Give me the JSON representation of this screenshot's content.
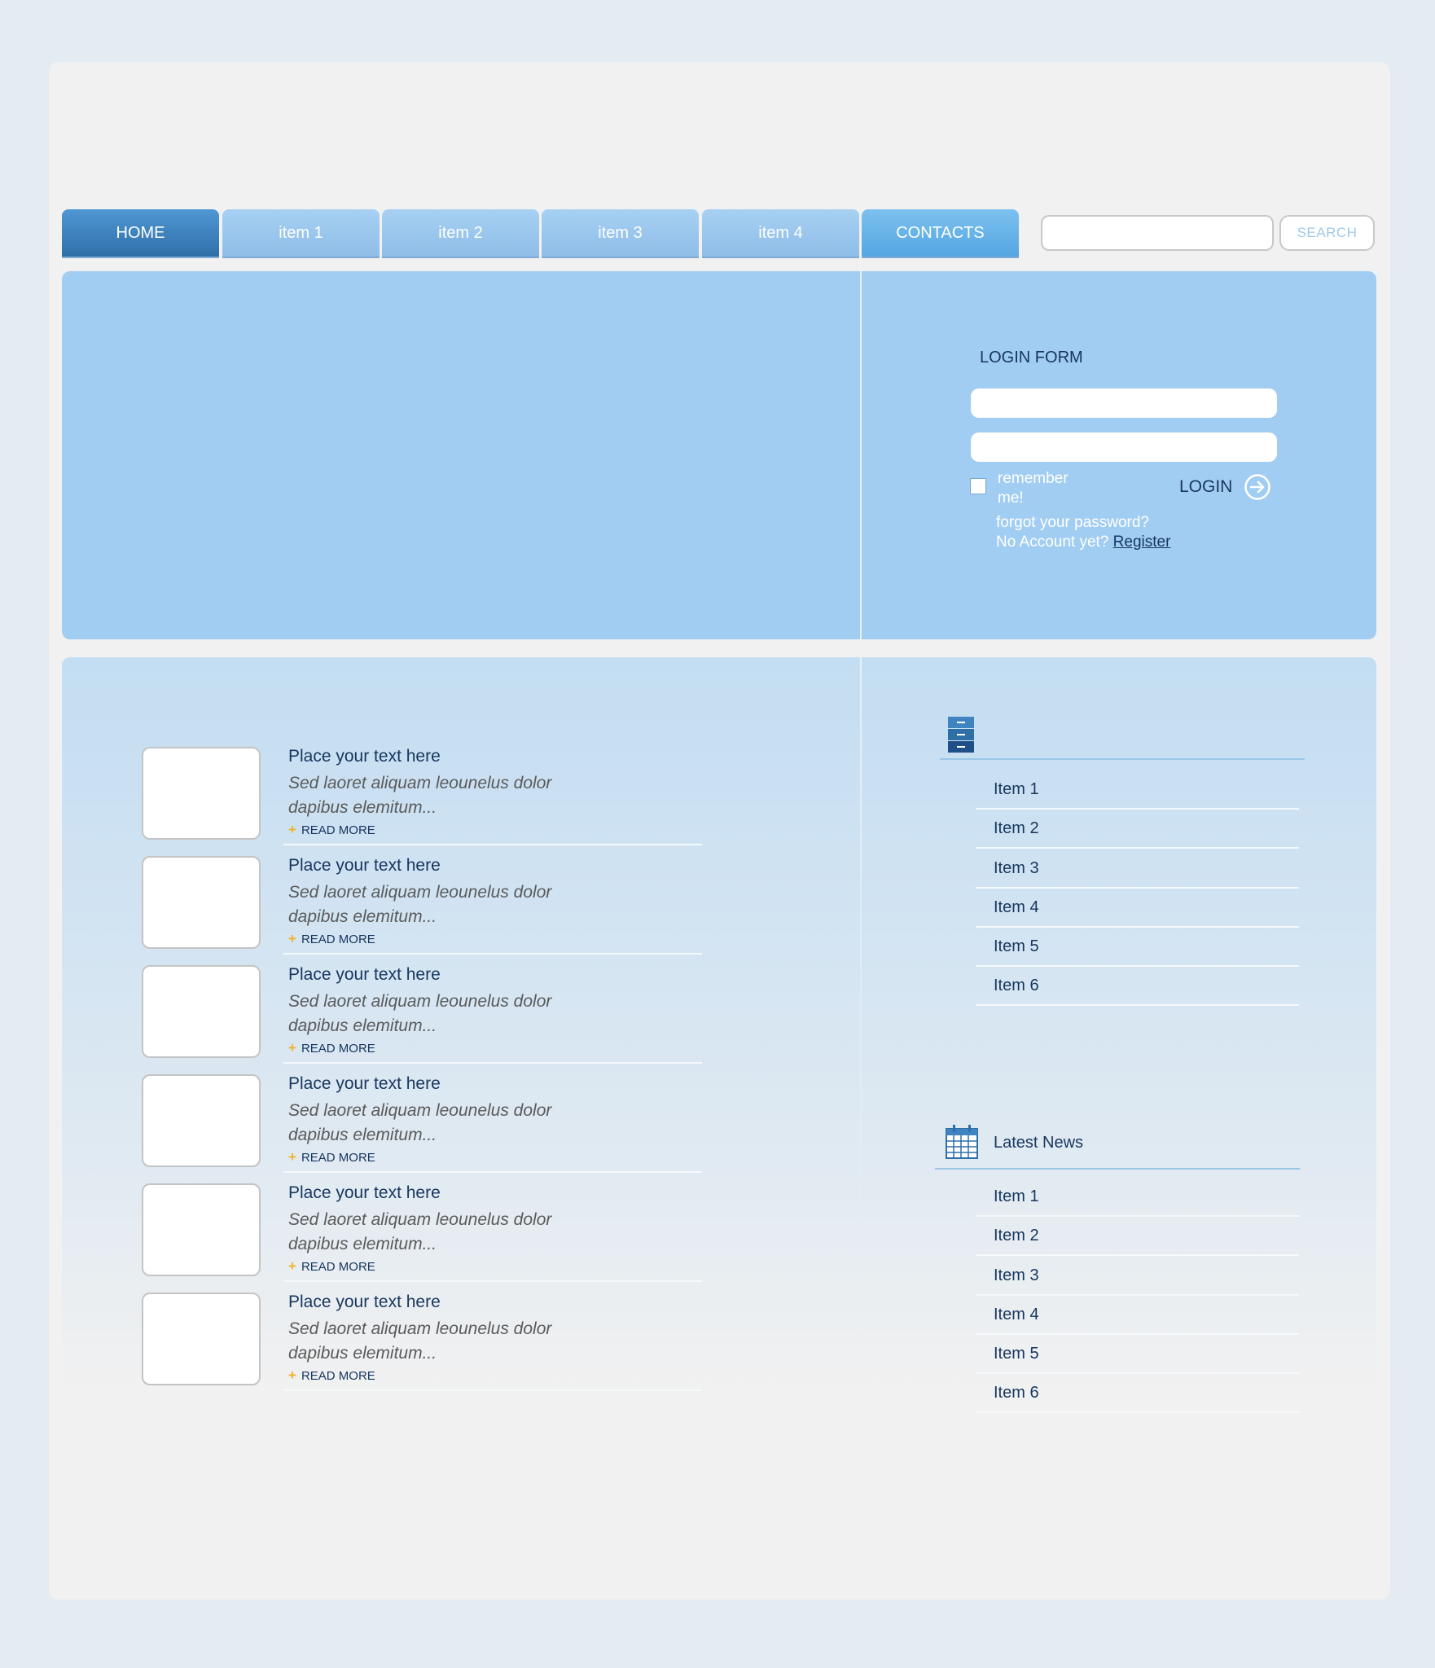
{
  "nav": {
    "tabs": [
      {
        "label": "HOME"
      },
      {
        "label": "item 1"
      },
      {
        "label": "item 2"
      },
      {
        "label": "item 3"
      },
      {
        "label": "item 4"
      },
      {
        "label": "CONTACTS"
      }
    ],
    "search_button": "SEARCH"
  },
  "login": {
    "title": "LOGIN FORM",
    "remember": "remember me!",
    "button": "LOGIN",
    "forgot": "forgot your password?",
    "no_account": "No Account yet?",
    "register": "Register"
  },
  "articles": [
    {
      "title": "Place your text here",
      "text": "Sed laoret aliquam leounelus dolor dapibus elemitum...",
      "more": "READ MORE"
    },
    {
      "title": "Place your text here",
      "text": "Sed laoret aliquam leounelus dolor dapibus elemitum...",
      "more": "READ MORE"
    },
    {
      "title": "Place your text here",
      "text": "Sed laoret aliquam leounelus dolor dapibus elemitum...",
      "more": "READ MORE"
    },
    {
      "title": "Place your text here",
      "text": "Sed laoret aliquam leounelus dolor dapibus elemitum...",
      "more": "READ MORE"
    },
    {
      "title": "Place your text here",
      "text": "Sed laoret aliquam leounelus dolor dapibus elemitum...",
      "more": "READ MORE"
    },
    {
      "title": "Place your text here",
      "text": "Sed laoret aliquam leounelus dolor dapibus elemitum...",
      "more": "READ MORE"
    }
  ],
  "sidebar_menu": {
    "icon": "cabinet-icon",
    "items": [
      "Item 1",
      "Item 2",
      "Item 3",
      "Item 4",
      "Item 5",
      "Item 6"
    ]
  },
  "latest_news": {
    "icon": "calendar-icon",
    "title": "Latest News",
    "items": [
      "Item 1",
      "Item 2",
      "Item 3",
      "Item 4",
      "Item 5",
      "Item 6"
    ]
  },
  "colors": {
    "background": "#e3ebf3",
    "page": "#f1f1f1",
    "hero": "#a1cdf2",
    "home_tab": "#3f84c0",
    "text_dark": "#17365e",
    "accent_plus": "#f0b429"
  }
}
